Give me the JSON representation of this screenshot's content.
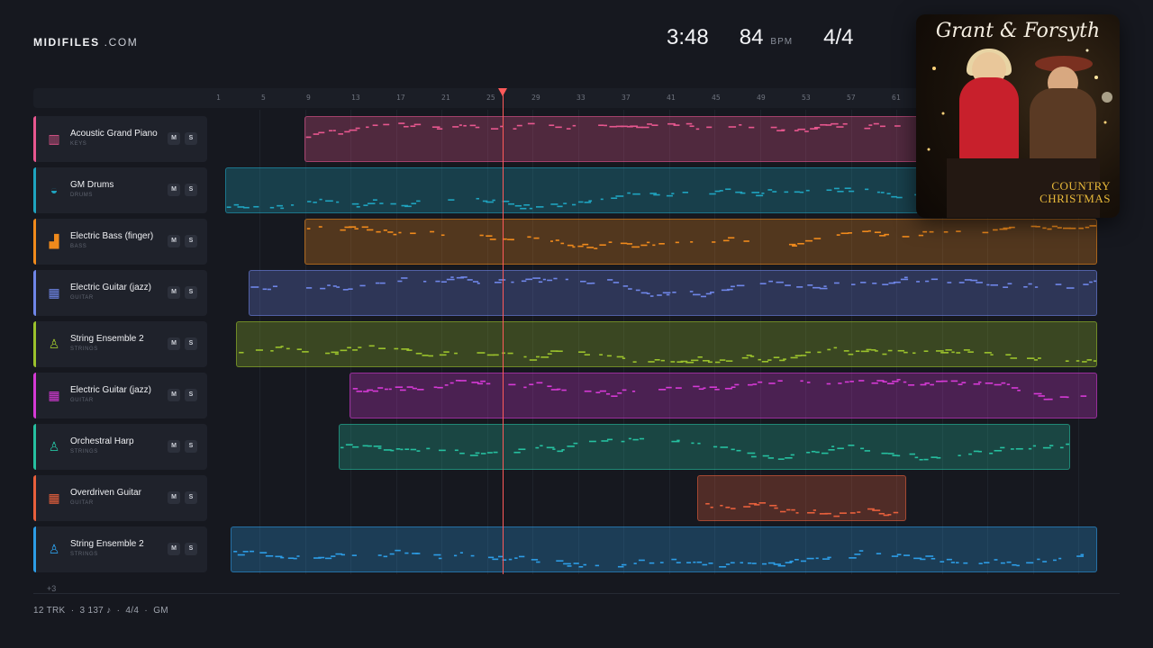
{
  "brand": {
    "name": "MIDIFILES",
    "suffix": ".COM"
  },
  "stats": {
    "time": "3:48",
    "bpm": "84",
    "bpm_label": "BPM",
    "signature": "4/4"
  },
  "album": {
    "title": "Grant & Forsyth",
    "subtitle_line1": "COUNTRY",
    "subtitle_line2": "CHRISTMAS"
  },
  "ruler": {
    "ticks": [
      "1",
      "5",
      "9",
      "13",
      "17",
      "21",
      "25",
      "29",
      "33",
      "37",
      "41",
      "45",
      "49",
      "53",
      "57",
      "61"
    ]
  },
  "tracks": [
    {
      "name": "Acoustic Grand Piano",
      "category": "KEYS",
      "color": "#e8578f",
      "icon": "piano-icon",
      "glyph": "▥"
    },
    {
      "name": "GM Drums",
      "category": "DRUMS",
      "color": "#1fa4c0",
      "icon": "drum-icon",
      "glyph": "◒"
    },
    {
      "name": "Electric Bass (finger)",
      "category": "BASS",
      "color": "#f08a1c",
      "icon": "bass-icon",
      "glyph": "▟"
    },
    {
      "name": "Electric Guitar (jazz)",
      "category": "GUITAR",
      "color": "#6f86e8",
      "icon": "guitar-grid-icon",
      "glyph": "▦"
    },
    {
      "name": "String Ensemble 2",
      "category": "STRINGS",
      "color": "#9bc22c",
      "icon": "violin-icon",
      "glyph": "♙"
    },
    {
      "name": "Electric Guitar (jazz)",
      "category": "GUITAR",
      "color": "#d63ad6",
      "icon": "guitar-grid-icon",
      "glyph": "▦"
    },
    {
      "name": "Orchestral Harp",
      "category": "STRINGS",
      "color": "#26c0a0",
      "icon": "violin-icon",
      "glyph": "♙"
    },
    {
      "name": "Overdriven Guitar",
      "category": "GUITAR",
      "color": "#e8603c",
      "icon": "guitar-grid-icon",
      "glyph": "▦"
    },
    {
      "name": "String Ensemble 2",
      "category": "STRINGS",
      "color": "#2d9de6",
      "icon": "violin-icon",
      "glyph": "♙"
    }
  ],
  "mute_label": "M",
  "solo_label": "S",
  "more_tracks": "+3",
  "footer": {
    "tracks": "12 TRK",
    "notes": "3 137 ♪",
    "signature": "4/4",
    "standard": "GM",
    "sep": "·"
  }
}
